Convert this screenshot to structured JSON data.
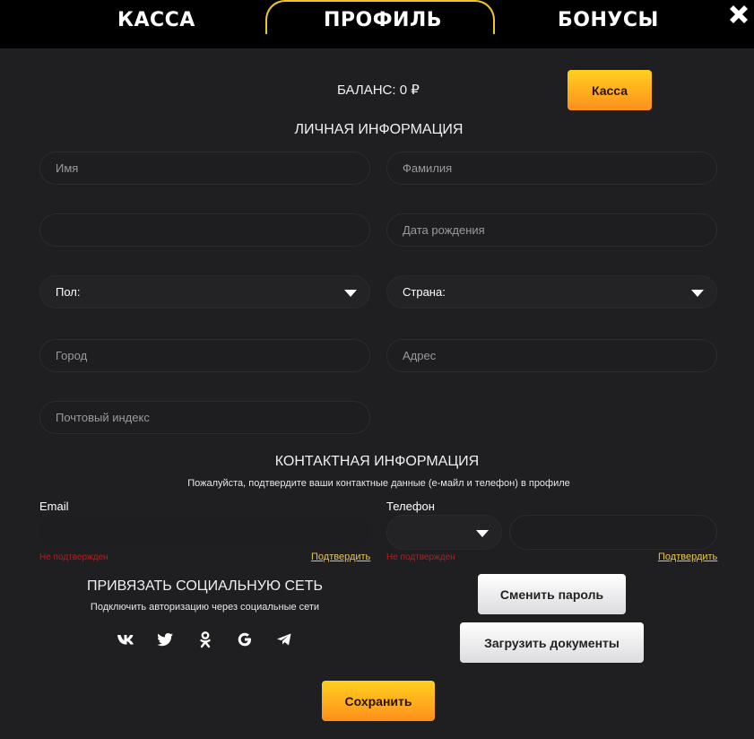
{
  "tabs": [
    {
      "label": "КАССА",
      "active": false
    },
    {
      "label": "ПРОФИЛЬ",
      "active": true
    },
    {
      "label": "БОНУСЫ",
      "active": false
    }
  ],
  "close_icon": "close-icon",
  "balance": {
    "text": "БАЛАНС: 0 ₽"
  },
  "cashier_button": "Касса",
  "personal": {
    "title": "ЛИЧНАЯ ИНФОРМАЦИЯ",
    "first_name": {
      "placeholder": "Имя",
      "value": ""
    },
    "last_name": {
      "placeholder": "Фамилия",
      "value": ""
    },
    "middle_field": {
      "placeholder": "",
      "value": ""
    },
    "birth_date": {
      "placeholder": "Дата рождения",
      "value": ""
    },
    "gender": {
      "selected": "Пол:"
    },
    "country": {
      "selected": "Страна:"
    },
    "city": {
      "placeholder": "Город",
      "value": ""
    },
    "address": {
      "placeholder": "Адрес",
      "value": ""
    },
    "postal_code": {
      "placeholder": "Почтовый индекс",
      "value": ""
    }
  },
  "contact": {
    "title": "КОНТАКТНАЯ ИНФОРМАЦИЯ",
    "subtitle": "Пожалуйста, подтвердите ваши контактные данные (е-майл и телефон) в профиле",
    "email": {
      "label": "Email",
      "value": "",
      "status": "Не подтвержден",
      "confirm": "Подтвердить"
    },
    "phone": {
      "label": "Телефон",
      "code": "",
      "value": "",
      "status": "Не подтвержден",
      "confirm": "Подтвердить"
    }
  },
  "social": {
    "title": "ПРИВЯЗАТЬ СОЦИАЛЬНУЮ СЕТЬ",
    "subtitle": "Подключить авторизацию через социальные сети",
    "networks": [
      "vk",
      "twitter",
      "odnoklassniki",
      "google",
      "telegram"
    ]
  },
  "buttons": {
    "change_password": "Сменить пароль",
    "upload_documents": "Загрузить документы",
    "save": "Сохранить"
  },
  "colors": {
    "accent": "#f2c628",
    "background": "#1f1f21",
    "error": "#b51c1c",
    "link": "#e8c64a"
  }
}
